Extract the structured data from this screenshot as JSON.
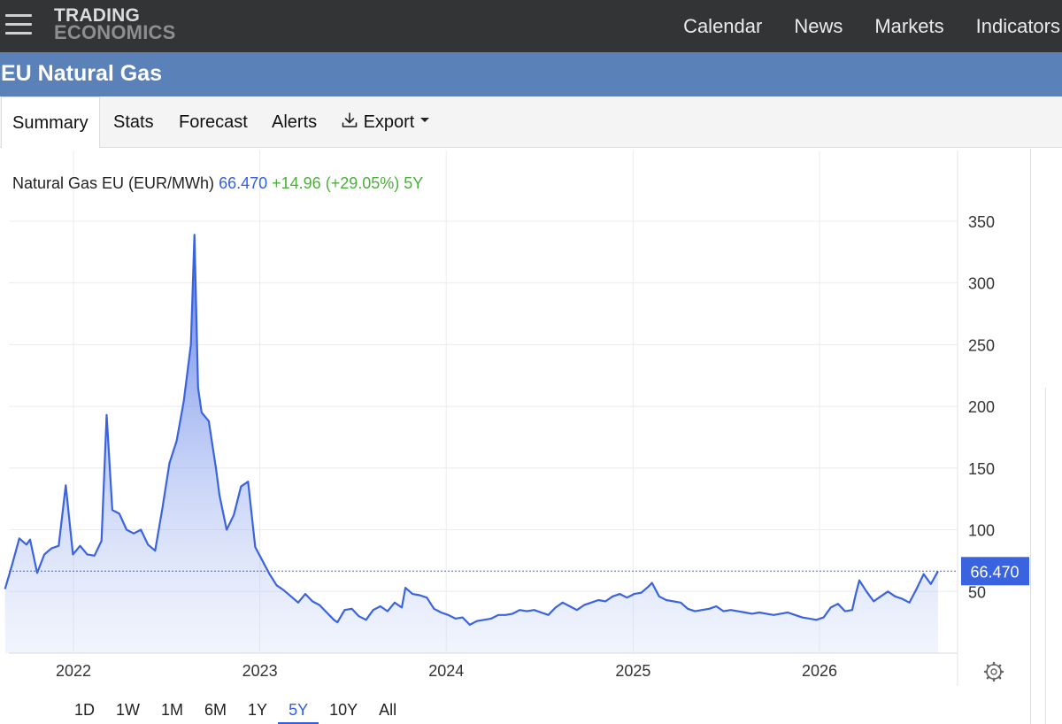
{
  "header": {
    "logo_line1": "TRADING",
    "logo_line2": "ECONOMICS",
    "nav": [
      "Calendar",
      "News",
      "Markets",
      "Indicators"
    ]
  },
  "page_title": "EU Natural Gas",
  "tabs": {
    "summary": "Summary",
    "stats": "Stats",
    "forecast": "Forecast",
    "alerts": "Alerts",
    "export": "Export"
  },
  "legend": {
    "name": "Natural Gas EU (EUR/MWh)",
    "price": "66.470",
    "change": "+14.96 (+29.05%) 5Y"
  },
  "ranges": [
    "1D",
    "1W",
    "1M",
    "6M",
    "1Y",
    "5Y",
    "10Y",
    "All"
  ],
  "active_range": "5Y",
  "colors": {
    "line": "#3a63e0",
    "price_label_bg": "#3a63e0",
    "change_positive": "#4caf3a",
    "title_bar": "#5a81b8"
  },
  "icons": {
    "menu": "hamburger-menu-icon",
    "export": "download-icon",
    "dropdown": "caret-down-icon",
    "settings": "gear-icon"
  },
  "chart_data": {
    "type": "area",
    "title": "Natural Gas EU (EUR/MWh)",
    "ylim": [
      0,
      375
    ],
    "y_ticks": [
      50,
      100,
      150,
      200,
      250,
      300,
      350
    ],
    "x_ticks": [
      "2022",
      "2023",
      "2024",
      "2025",
      "2026"
    ],
    "last_value": "66.470",
    "grid": true,
    "series": [
      {
        "name": "Natural Gas EU",
        "points": [
          [
            "2021-08-20",
            52
          ],
          [
            "2021-09-03",
            72
          ],
          [
            "2021-09-17",
            93
          ],
          [
            "2021-10-01",
            88
          ],
          [
            "2021-10-08",
            92
          ],
          [
            "2021-10-22",
            65
          ],
          [
            "2021-11-05",
            80
          ],
          [
            "2021-11-19",
            85
          ],
          [
            "2021-12-03",
            87
          ],
          [
            "2021-12-17",
            136
          ],
          [
            "2021-12-31",
            80
          ],
          [
            "2022-01-14",
            87
          ],
          [
            "2022-01-28",
            80
          ],
          [
            "2022-02-11",
            79
          ],
          [
            "2022-02-25",
            91
          ],
          [
            "2022-03-07",
            193
          ],
          [
            "2022-03-18",
            116
          ],
          [
            "2022-04-01",
            113
          ],
          [
            "2022-04-15",
            100
          ],
          [
            "2022-04-29",
            97
          ],
          [
            "2022-05-13",
            100
          ],
          [
            "2022-05-27",
            88
          ],
          [
            "2022-06-10",
            83
          ],
          [
            "2022-06-24",
            117
          ],
          [
            "2022-07-08",
            154
          ],
          [
            "2022-07-22",
            172
          ],
          [
            "2022-08-05",
            204
          ],
          [
            "2022-08-19",
            250
          ],
          [
            "2022-08-26",
            339
          ],
          [
            "2022-09-02",
            215
          ],
          [
            "2022-09-09",
            195
          ],
          [
            "2022-09-23",
            188
          ],
          [
            "2022-10-07",
            150
          ],
          [
            "2022-10-14",
            128
          ],
          [
            "2022-10-28",
            100
          ],
          [
            "2022-11-11",
            112
          ],
          [
            "2022-11-25",
            135
          ],
          [
            "2022-12-09",
            139
          ],
          [
            "2022-12-23",
            86
          ],
          [
            "2023-01-06",
            75
          ],
          [
            "2023-01-20",
            64
          ],
          [
            "2023-02-03",
            55
          ],
          [
            "2023-02-17",
            51
          ],
          [
            "2023-03-03",
            46
          ],
          [
            "2023-03-17",
            41
          ],
          [
            "2023-03-31",
            48
          ],
          [
            "2023-04-14",
            42
          ],
          [
            "2023-04-28",
            39
          ],
          [
            "2023-05-12",
            33
          ],
          [
            "2023-05-26",
            27
          ],
          [
            "2023-06-02",
            25
          ],
          [
            "2023-06-16",
            35
          ],
          [
            "2023-06-30",
            36
          ],
          [
            "2023-07-14",
            30
          ],
          [
            "2023-07-28",
            27
          ],
          [
            "2023-08-11",
            35
          ],
          [
            "2023-08-25",
            38
          ],
          [
            "2023-09-08",
            34
          ],
          [
            "2023-09-22",
            41
          ],
          [
            "2023-10-06",
            37
          ],
          [
            "2023-10-13",
            53
          ],
          [
            "2023-10-27",
            48
          ],
          [
            "2023-11-10",
            47
          ],
          [
            "2023-11-24",
            45
          ],
          [
            "2023-12-08",
            36
          ],
          [
            "2023-12-22",
            33
          ],
          [
            "2024-01-05",
            31
          ],
          [
            "2024-01-19",
            28
          ],
          [
            "2024-02-02",
            29
          ],
          [
            "2024-02-16",
            23
          ],
          [
            "2024-03-01",
            26
          ],
          [
            "2024-03-15",
            27
          ],
          [
            "2024-03-29",
            28
          ],
          [
            "2024-04-12",
            31
          ],
          [
            "2024-04-26",
            31
          ],
          [
            "2024-05-10",
            32
          ],
          [
            "2024-05-24",
            35
          ],
          [
            "2024-06-07",
            34
          ],
          [
            "2024-06-21",
            35
          ],
          [
            "2024-07-05",
            33
          ],
          [
            "2024-07-19",
            31
          ],
          [
            "2024-08-02",
            37
          ],
          [
            "2024-08-16",
            41
          ],
          [
            "2024-08-30",
            38
          ],
          [
            "2024-09-13",
            35
          ],
          [
            "2024-09-27",
            39
          ],
          [
            "2024-10-11",
            41
          ],
          [
            "2024-10-25",
            43
          ],
          [
            "2024-11-08",
            42
          ],
          [
            "2024-11-22",
            46
          ],
          [
            "2024-12-06",
            48
          ],
          [
            "2024-12-20",
            45
          ],
          [
            "2025-01-03",
            48
          ],
          [
            "2025-01-17",
            49
          ],
          [
            "2025-01-31",
            54
          ],
          [
            "2025-02-07",
            57
          ],
          [
            "2025-02-21",
            46
          ],
          [
            "2025-03-07",
            43
          ],
          [
            "2025-03-21",
            42
          ],
          [
            "2025-04-04",
            41
          ],
          [
            "2025-04-18",
            36
          ],
          [
            "2025-05-02",
            34
          ],
          [
            "2025-05-16",
            35
          ],
          [
            "2025-05-30",
            36
          ],
          [
            "2025-06-13",
            38
          ],
          [
            "2025-06-27",
            34
          ],
          [
            "2025-07-11",
            35
          ],
          [
            "2025-07-25",
            34
          ],
          [
            "2025-08-08",
            33
          ],
          [
            "2025-08-22",
            32
          ],
          [
            "2025-09-05",
            33
          ],
          [
            "2025-09-19",
            32
          ],
          [
            "2025-10-03",
            31
          ],
          [
            "2025-10-17",
            32
          ],
          [
            "2025-10-31",
            33
          ],
          [
            "2025-11-14",
            31
          ],
          [
            "2025-11-28",
            29
          ],
          [
            "2025-12-12",
            28
          ],
          [
            "2025-12-26",
            27
          ],
          [
            "2026-01-09",
            29
          ],
          [
            "2026-01-23",
            37
          ],
          [
            "2026-02-06",
            40
          ],
          [
            "2026-02-20",
            34
          ],
          [
            "2026-03-06",
            35
          ],
          [
            "2026-03-13",
            48
          ],
          [
            "2026-03-20",
            59
          ],
          [
            "2026-04-03",
            50
          ],
          [
            "2026-04-17",
            42
          ],
          [
            "2026-05-01",
            46
          ],
          [
            "2026-05-15",
            50
          ],
          [
            "2026-05-29",
            46
          ],
          [
            "2026-06-12",
            44
          ],
          [
            "2026-06-26",
            41
          ],
          [
            "2026-07-10",
            52
          ],
          [
            "2026-07-24",
            64
          ],
          [
            "2026-08-07",
            56
          ],
          [
            "2026-08-21",
            66.47
          ]
        ]
      }
    ]
  }
}
